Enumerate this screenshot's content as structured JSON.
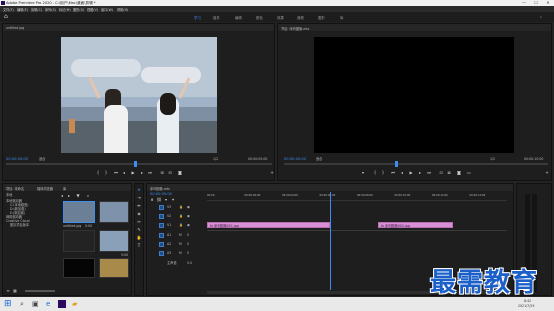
{
  "titlebar": {
    "title": "Adobe Premiere Pro 2020 - C:\\用户\\Mac\\桌面\\剪辑 *",
    "minimize": "—",
    "maximize": "☐",
    "close": "✕"
  },
  "menu": [
    "文件(F)",
    "编辑(E)",
    "剪辑(C)",
    "序列(S)",
    "标记(M)",
    "图形(G)",
    "视图(V)",
    "窗口(W)",
    "帮助(H)"
  ],
  "workspaces": [
    "学习",
    "组件",
    "编辑",
    "颜色",
    "效果",
    "音频",
    "图形",
    "库"
  ],
  "source_monitor": {
    "title": "untitled.jpg",
    "timecode_left": "00:00:00:00",
    "fit": "适合",
    "scale": "1/2",
    "timecode_right": "00:00:05:00"
  },
  "program_monitor": {
    "title": "节目: 序列图像.mts",
    "timecode_left": "00:00:00:00",
    "fit": "适合",
    "scale": "1/2",
    "timecode_right": "00:00:10:00",
    "playhead_fraction": 0.42
  },
  "project_panel": {
    "tabs": [
      "项目: 未命名",
      "媒体浏览器",
      "库"
    ],
    "path_label": "本地",
    "tree": [
      "本地驱动器",
      "C:(本地磁盘)",
      "D:(新加卷)",
      "E:(新加卷)",
      "网络驱动器",
      "Creative Cloud",
      "团队项目版本"
    ],
    "items": [
      {
        "name": "untitled.jpg",
        "dur": "5:00"
      },
      {
        "name": "",
        "dur": ""
      },
      {
        "name": "",
        "dur": ""
      },
      {
        "name": "",
        "dur": "5:00"
      },
      {
        "name": "",
        "dur": ""
      },
      {
        "name": "",
        "dur": ""
      }
    ]
  },
  "timeline": {
    "title": "序列图像.mts",
    "timecode": "00:00:05:00",
    "tracks_video": [
      "V3",
      "V2",
      "V1"
    ],
    "tracks_audio": [
      "A1",
      "A2",
      "A3"
    ],
    "master": "主声道",
    "master_value": "0.0",
    "ruler": [
      "00:00",
      "00:00:02:00",
      "00:00:04:00",
      "00:00:06:00",
      "00:00:08:00",
      "00:00:10:00",
      "00:00:12:00",
      "00:00:14:00"
    ],
    "clips": [
      {
        "label": "fx 序列图像001.jpg",
        "start": 0.0,
        "end": 0.41
      },
      {
        "label": "fx 序列图像002.jpg",
        "start": 0.57,
        "end": 0.82
      }
    ],
    "playhead_fraction": 0.41
  },
  "taskbar": {
    "search_hint": "在这里输入你要搜索的内容",
    "time": "8:42",
    "date": "2021/7/29"
  },
  "watermark": "最需教育"
}
